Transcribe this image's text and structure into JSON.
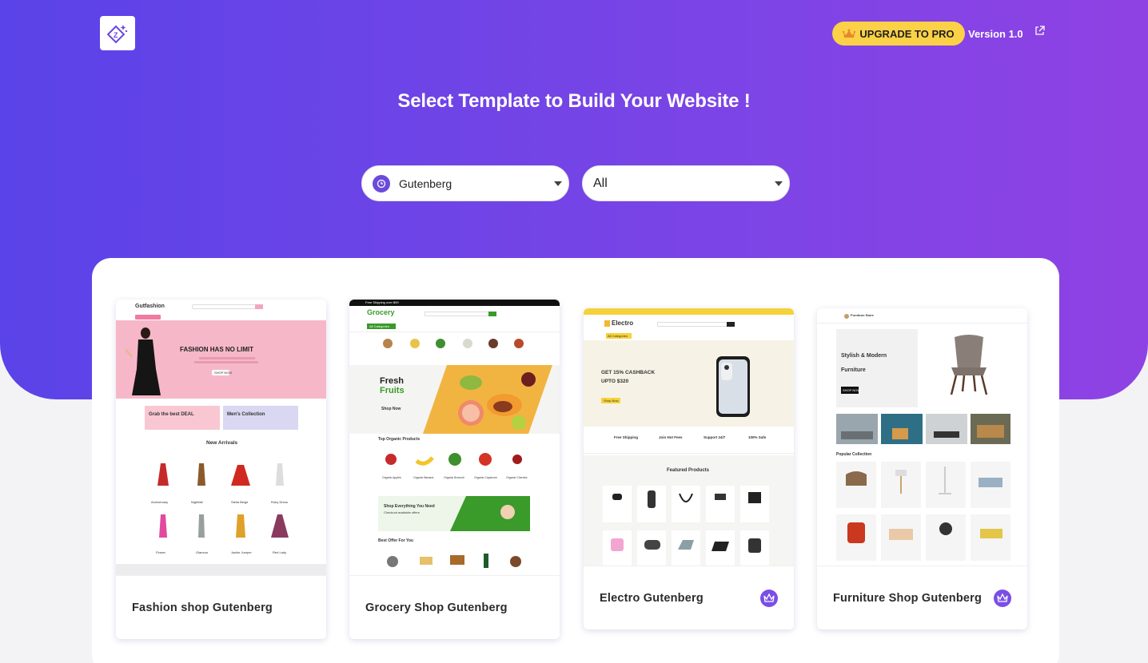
{
  "header": {
    "logo_icon": "zita-logo-icon",
    "upgrade_label": "UPGRADE TO PRO",
    "upgrade_icon": "crown-icon",
    "version": "Version 1.0",
    "external_icon": "external-link-icon",
    "title": "Select Template to Build Your Website !"
  },
  "filters": {
    "builder": {
      "value": "Gutenberg",
      "icon": "gutenberg-icon"
    },
    "category": {
      "value": "All"
    }
  },
  "colors": {
    "gradient_start": "#5a43e8",
    "gradient_end": "#8f42e4",
    "pro_button": "#fbd147",
    "crown_badge": "#7b4ee6"
  },
  "templates": [
    {
      "name": "Fashion shop Gutenberg",
      "pro": false,
      "preview": {
        "logo": "Gutfashion",
        "search": "Search",
        "hero": "FASHION HAS NO LIMIT",
        "cta": "SHOP NOW",
        "promo1": "Grab the best DEAL",
        "promo2": "Men's Collection",
        "section": "New Arrivals",
        "products": [
          "Anniversary",
          "Nightfall",
          "Stella Beige",
          "Ruby Dress",
          "Flower",
          "Glamour",
          "Jackie Jumper",
          "Red Lady"
        ]
      }
    },
    {
      "name": "Grocery Shop Gutenberg",
      "pro": false,
      "preview": {
        "logo": "Grocery",
        "top_bar": "Free Shipping over $99",
        "categories_btn": "All Categories",
        "hero_line1": "Fresh",
        "hero_line2": "Fruits",
        "cta": "Shop Now",
        "section1": "Top Organic Products",
        "products": [
          "Organic Apples",
          "Organic Banana",
          "Organic Broccoli",
          "Organic Capsicum",
          "Organic Cherries"
        ],
        "banner": "Shop Everything You Need",
        "banner_sub": "Checkout available offers",
        "section2": "Best Offer For You"
      }
    },
    {
      "name": "Electro Gutenberg",
      "pro": true,
      "preview": {
        "logo": "Electro",
        "categories_btn": "All Categories",
        "hero_line1": "GET 15% CASHBACK",
        "hero_line2": "UPTO $320",
        "cta": "Shop Now",
        "features": [
          "Free Shipping",
          "Join Hot Fees",
          "Support 24/7",
          "100% Safe"
        ],
        "section": "Featured Products"
      }
    },
    {
      "name": "Furniture Shop Gutenberg",
      "pro": true,
      "preview": {
        "logo": "Furniture Store",
        "hero_line1": "Stylish & Modern",
        "hero_line2": "Furniture",
        "cta": "SHOP NOW",
        "section": "Popular Collection"
      }
    }
  ]
}
